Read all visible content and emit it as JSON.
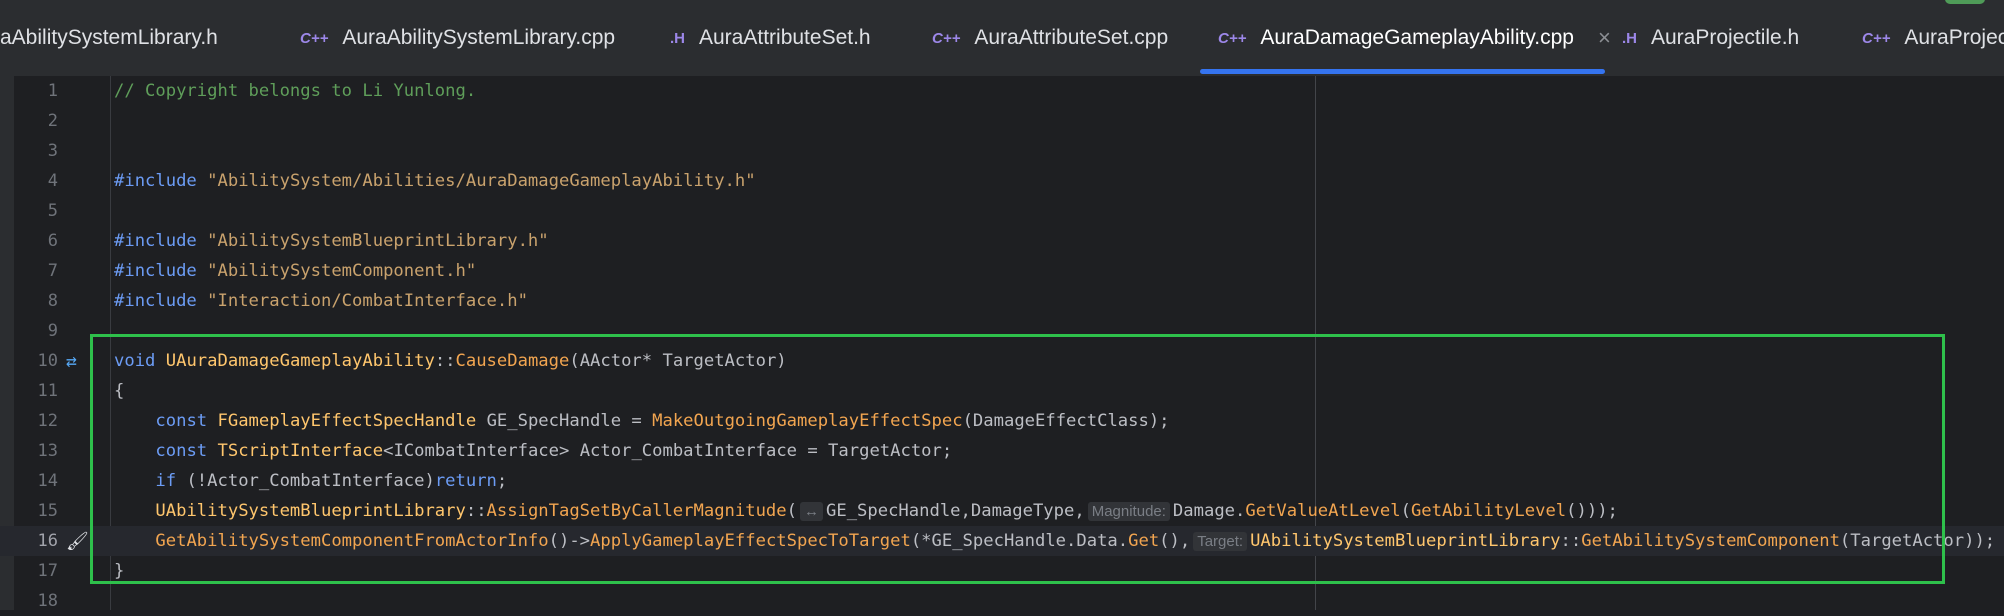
{
  "tabs": [
    {
      "label": "aAbilitySystemLibrary.h",
      "type": "",
      "active": false
    },
    {
      "label": "AuraAbilitySystemLibrary.cpp",
      "type": "C++",
      "active": false
    },
    {
      "label": "AuraAttributeSet.h",
      "type": ".H",
      "active": false
    },
    {
      "label": "AuraAttributeSet.cpp",
      "type": "C++",
      "active": false
    },
    {
      "label": "AuraDamageGameplayAbility.cpp",
      "type": "C++",
      "active": true
    },
    {
      "label": "AuraProjectile.h",
      "type": ".H",
      "active": false
    },
    {
      "label": "AuraProjecti",
      "type": "C++",
      "active": false
    }
  ],
  "tab_close_glyph": "×",
  "editor": {
    "line_numbers": [
      "1",
      "2",
      "3",
      "4",
      "5",
      "6",
      "7",
      "8",
      "9",
      "10",
      "11",
      "12",
      "13",
      "14",
      "15",
      "16",
      "17",
      "18"
    ],
    "comment": "// Copyright belongs to Li Yunlong.",
    "include_kw": "#include",
    "includes": [
      "\"AbilitySystem/Abilities/AuraDamageGameplayAbility.h\"",
      "\"AbilitySystemBlueprintLibrary.h\"",
      "\"AbilitySystemComponent.h\"",
      "\"Interaction/CombatInterface.h\""
    ],
    "l10": {
      "void": "void",
      "cls": "UAuraDamageGameplayAbility",
      "sep": "::",
      "fn": "CauseDamage",
      "args": "(AActor* TargetActor)"
    },
    "l11": "{",
    "l12": {
      "const": "const",
      "type": "FGameplayEffectSpecHandle",
      "rest": " GE_SpecHandle = ",
      "fn": "MakeOutgoingGameplayEffectSpec",
      "args": "(DamageEffectClass);"
    },
    "l13": {
      "const": "const",
      "type": "TScriptInterface",
      "tpl": "<ICombatInterface>",
      "rest": " Actor_CombatInterface = TargetActor;"
    },
    "l14": {
      "if": "if",
      "cond": " (!Actor_CombatInterface)",
      "ret": "return",
      "end": ";"
    },
    "l15": {
      "cls": "UAbilitySystemBlueprintLibrary",
      "sep": "::",
      "fn": "AssignTagSetByCallerMagnitude",
      "open": "(",
      "hint1": "↔",
      "a1": "GE_SpecHandle,DamageType,",
      "hint2": "Magnitude:",
      "a2": "Damage.",
      "fn2": "GetValueAtLevel",
      "open2": "(",
      "fn3": "GetAbilityLevel",
      "end": "()));"
    },
    "l16": {
      "fn": "GetAbilitySystemComponentFromActorInfo",
      "arrow": "()->",
      "fn2": "ApplyGameplayEffectSpecToTarget",
      "a1": "(*GE_SpecHandle.Data.",
      "fn3": "Get",
      "a2": "(),",
      "hint": "Target:",
      "cls": "UAbilitySystemBlueprintLibrary",
      "sep": "::",
      "fn4": "GetAbilitySystemComponent",
      "end": "(TargetActor));"
    },
    "l17": "}"
  },
  "colors": {
    "accent": "#3574f0",
    "highlight_box": "#2ec04b"
  }
}
